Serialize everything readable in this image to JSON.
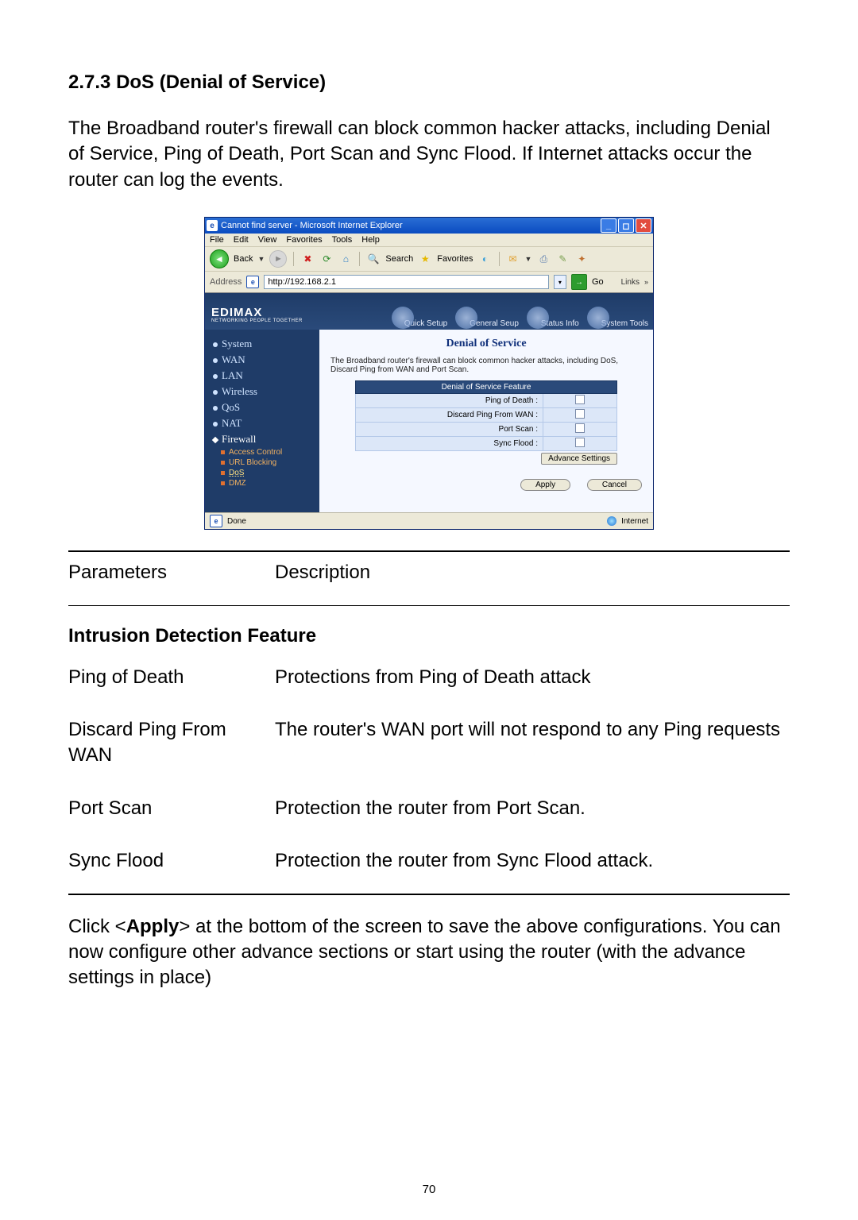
{
  "doc": {
    "section_number": "2.7.3",
    "section_title": "DoS (Denial of Service)",
    "intro": "The Broadband router's firewall can block common hacker attacks, including Denial of Service, Ping of Death, Port Scan and Sync Flood. If Internet attacks occur the router can log the events.",
    "table_header": {
      "c1": "Parameters",
      "c2": "Description"
    },
    "subheading": "Intrusion Detection Feature",
    "rows": [
      {
        "c1": "Ping of Death",
        "c2": "Protections from Ping of Death attack"
      },
      {
        "c1": "Discard Ping From WAN",
        "c2": "The router's WAN port will not respond to any Ping requests"
      },
      {
        "c1": "Port Scan",
        "c2": "Protection the router from Port Scan."
      },
      {
        "c1": "Sync Flood",
        "c2": "Protection the router from Sync Flood attack."
      }
    ],
    "apply_note_pre": "Click <",
    "apply_word": "Apply",
    "apply_note_post": "> at the bottom of the screen to save the above configurations. You can now configure other advance sections or start using the router (with the advance settings in place)",
    "page_number": "70"
  },
  "ie": {
    "title": "Cannot find server - Microsoft Internet Explorer",
    "menus": [
      "File",
      "Edit",
      "View",
      "Favorites",
      "Tools",
      "Help"
    ],
    "back": "Back",
    "search": "Search",
    "favorites": "Favorites",
    "address_label": "Address",
    "address_value": "http://192.168.2.1",
    "go": "Go",
    "links": "Links",
    "status_done": "Done",
    "status_zone": "Internet"
  },
  "router": {
    "brand": "EDIMAX",
    "brand_sub": "NETWORKING PEOPLE TOGETHER",
    "topnav": [
      "Quick Setup",
      "General Seup",
      "Status Info",
      "System Tools"
    ],
    "menu": [
      "System",
      "WAN",
      "LAN",
      "Wireless",
      "QoS",
      "NAT",
      "Firewall"
    ],
    "submenu": [
      "Access Control",
      "URL Blocking",
      "DoS",
      "DMZ"
    ],
    "content_title": "Denial of Service",
    "content_desc": "The Broadband router's firewall can block common hacker attacks, including DoS, Discard Ping from WAN and Port Scan.",
    "feature_header": "Denial of Service Feature",
    "features": [
      "Ping of Death :",
      "Discard Ping From WAN :",
      "Port Scan :",
      "Sync Flood :"
    ],
    "advance_btn": "Advance Settings",
    "apply_btn": "Apply",
    "cancel_btn": "Cancel"
  }
}
